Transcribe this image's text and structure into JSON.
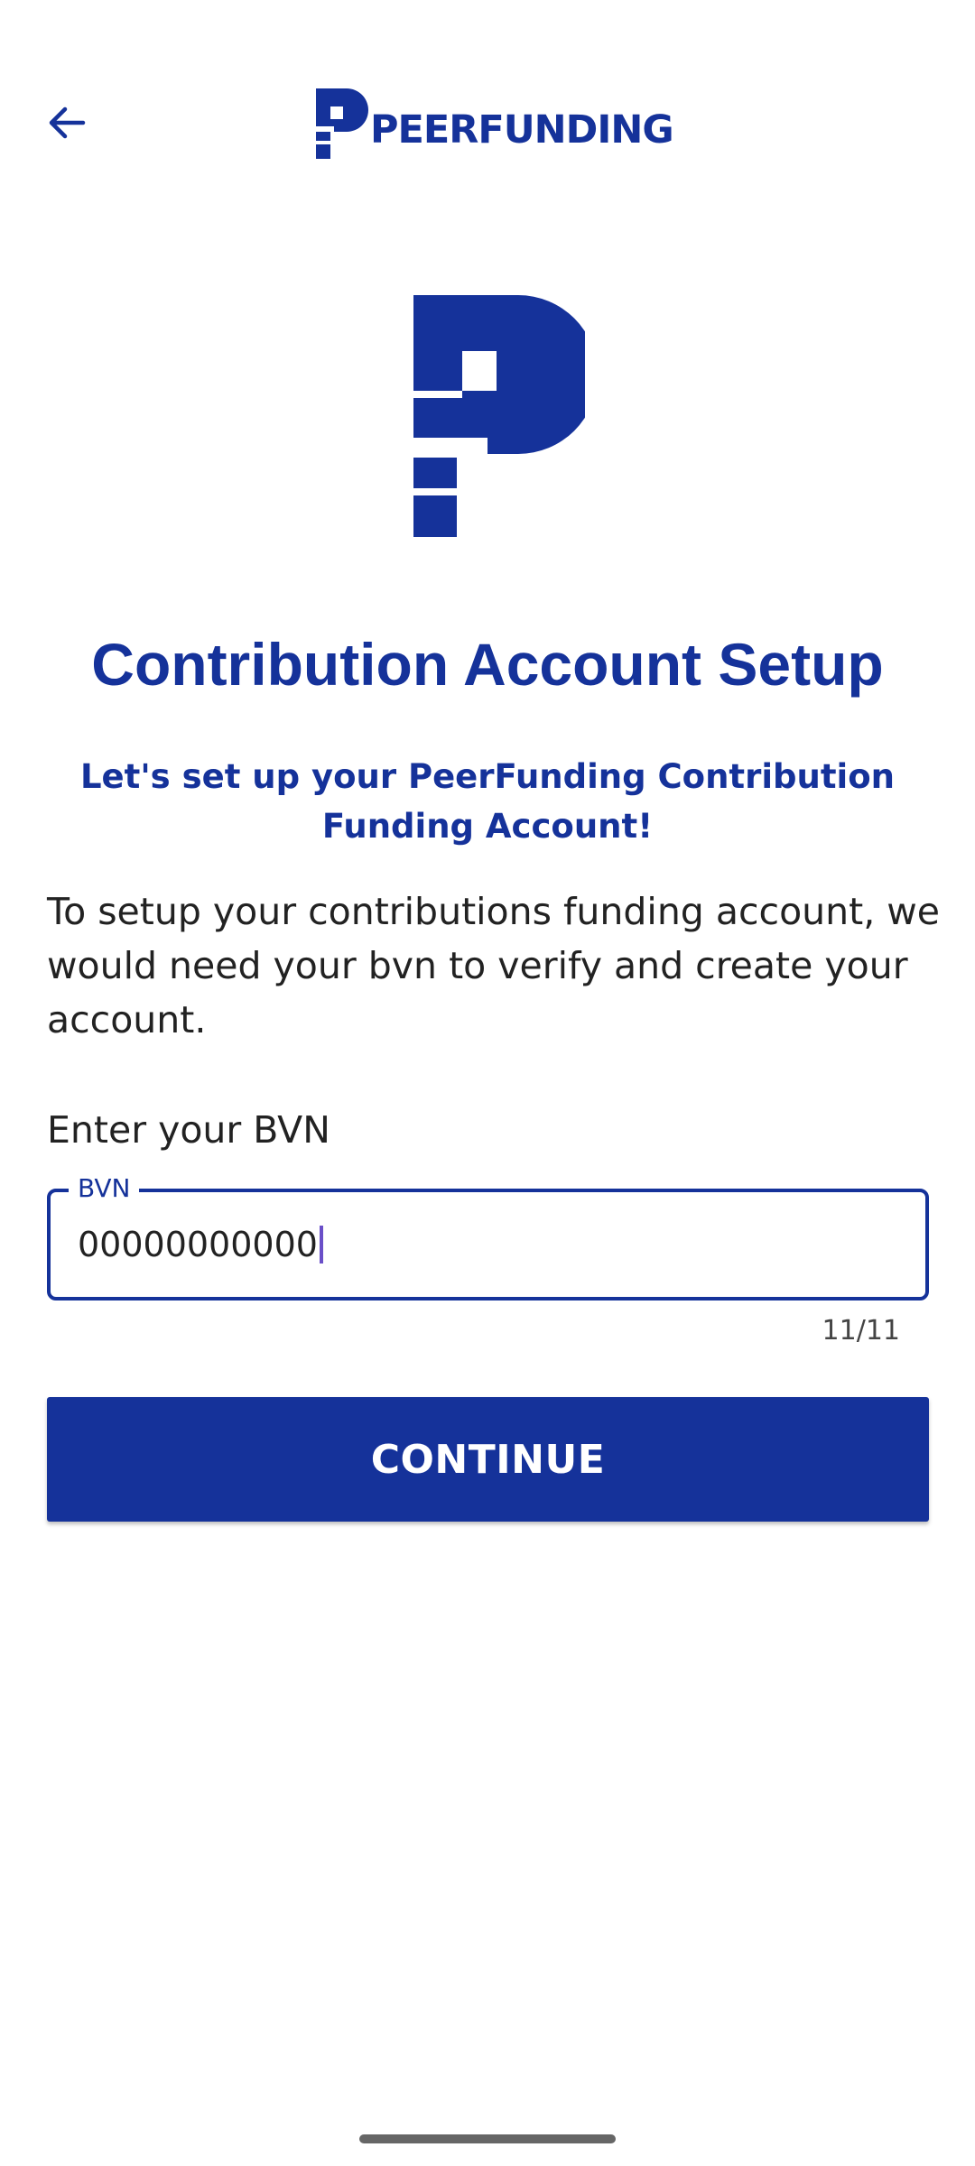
{
  "header": {
    "back_icon": "arrow-left-icon",
    "brand_name": "PEERFUNDING"
  },
  "brand": {
    "color": "#15329a",
    "logo_icon": "peerfunding-p-logo"
  },
  "main": {
    "title": "Contribution Account Setup",
    "subtitle": "Let's set up your PeerFunding Contribution Funding Account!",
    "description": "To setup your contributions funding account, we would need your bvn to verify and create your account.",
    "field_caption": "Enter your BVN",
    "bvn_field": {
      "label": "BVN",
      "value": "00000000000",
      "counter": "11/11"
    },
    "continue_label": "CONTINUE"
  }
}
